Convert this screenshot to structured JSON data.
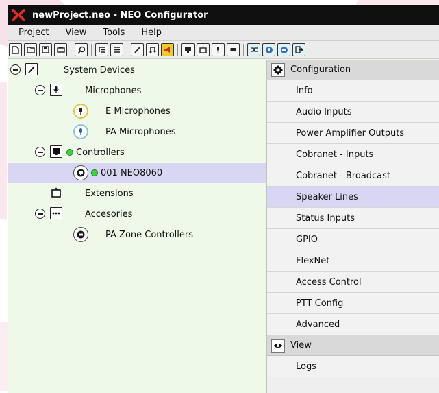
{
  "window": {
    "title": "newProject.neo - NEO Configurator"
  },
  "menu": [
    "Project",
    "View",
    "Tools",
    "Help"
  ],
  "tree": {
    "root": "System Devices",
    "microphones": "Microphones",
    "e_microphones": "E Microphones",
    "pa_microphones": "PA Microphones",
    "controllers": "Controllers",
    "controller_item": "001 NEO8060",
    "extensions": "Extensions",
    "accessories": "Accesories",
    "pa_zone_controllers": "PA Zone Controllers"
  },
  "configuration": {
    "header": "Configuration",
    "items": [
      "Info",
      "Audio Inputs",
      "Power Amplifier Outputs",
      "Cobranet - Inputs",
      "Cobranet - Broadcast",
      "Speaker Lines",
      "Status Inputs",
      "GPIO",
      "FlexNet",
      "Access Control",
      "PTT Config",
      "Advanced"
    ],
    "selected_item": "Speaker Lines"
  },
  "view": {
    "header": "View",
    "items": [
      "Logs"
    ]
  },
  "colors": {
    "tree_bg": "#eef9e9",
    "selected": "#d8d6f3",
    "titlebar": "#0f0f0f",
    "status_green": "#3fd23f",
    "logo_red": "#e02a2a"
  }
}
